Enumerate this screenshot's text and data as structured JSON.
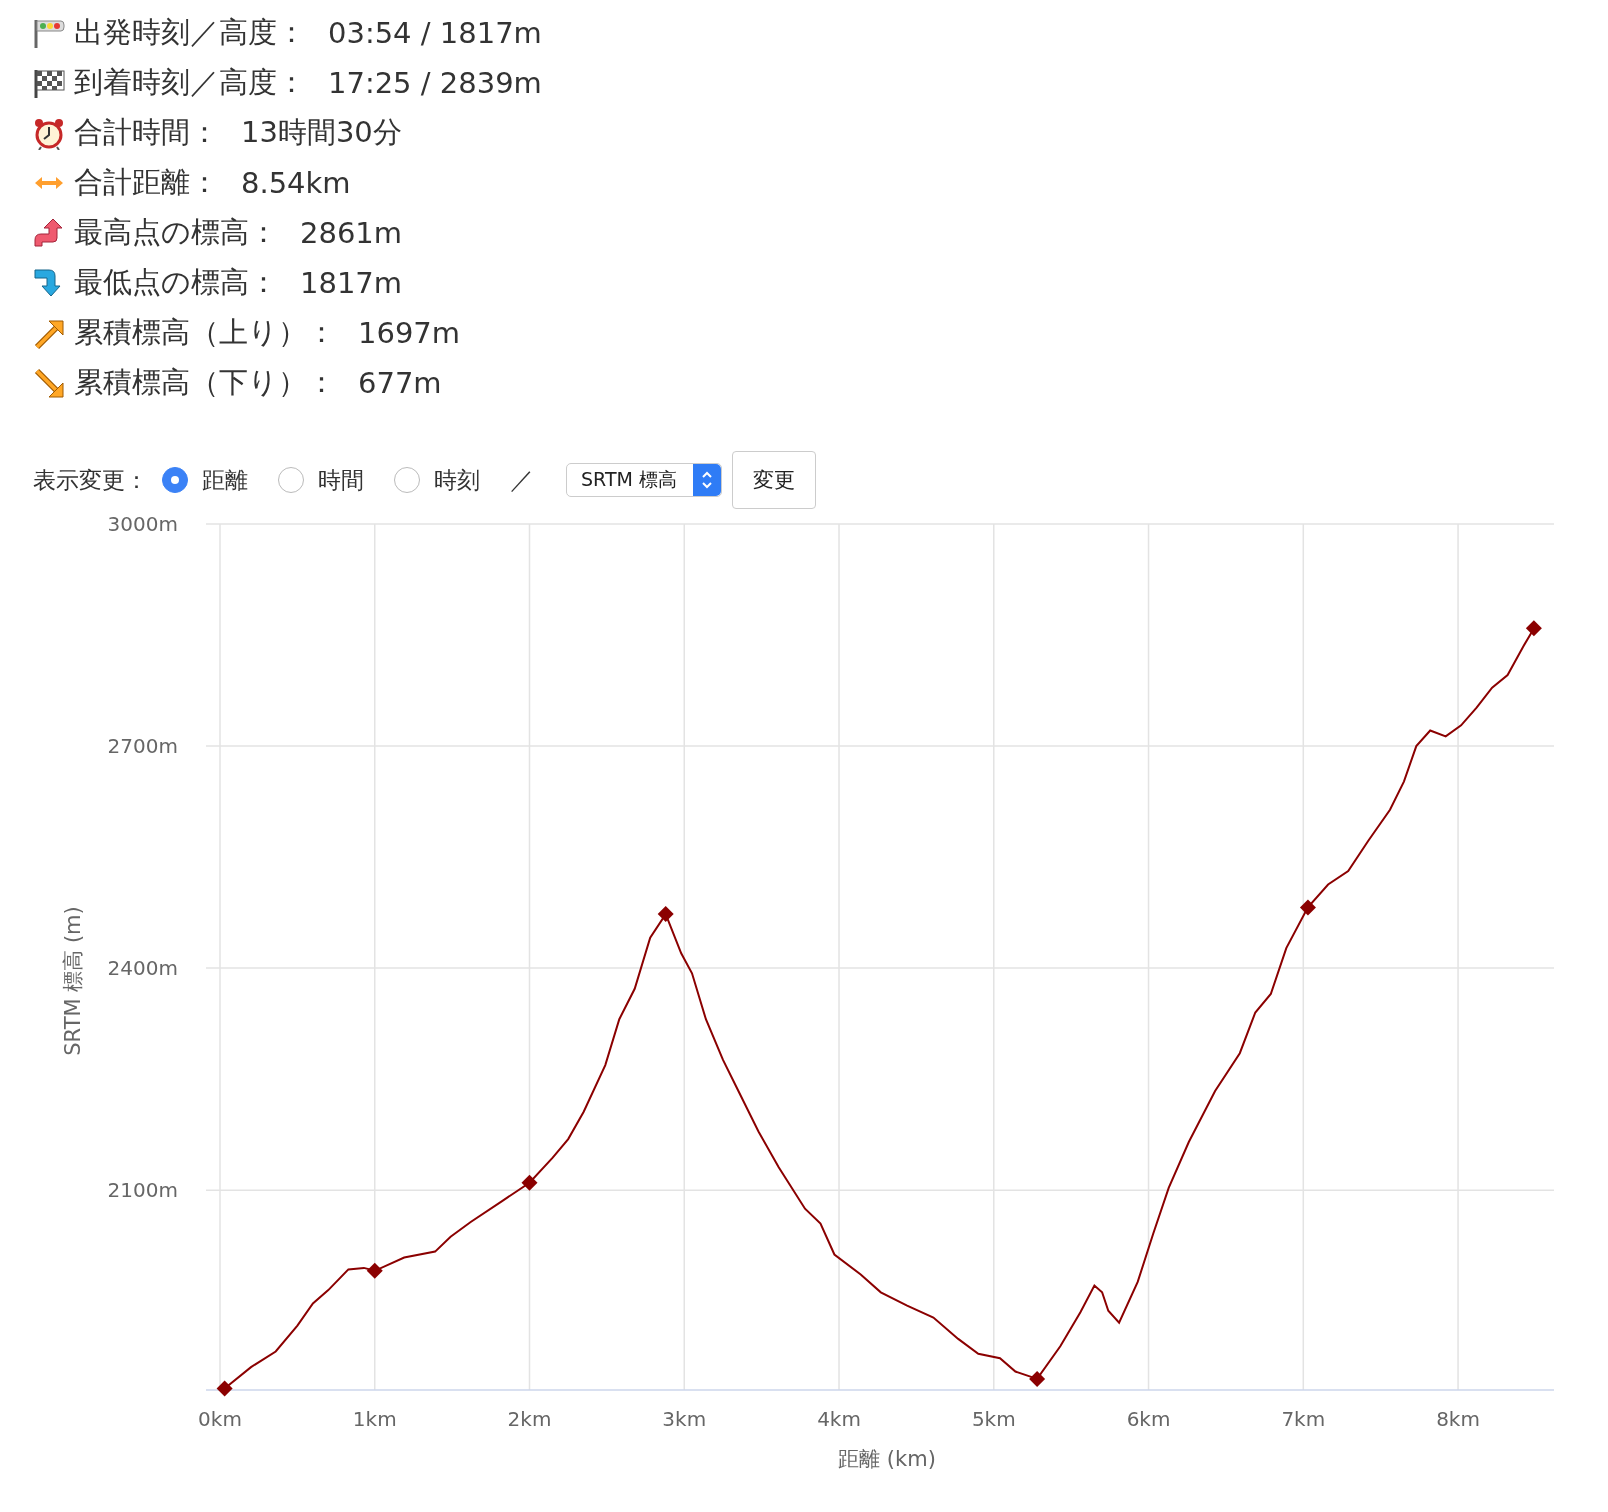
{
  "stats": [
    {
      "kind": "start",
      "label": "出発時刻／高度：",
      "value": "03:54 / 1817m"
    },
    {
      "kind": "finish",
      "label": "到着時刻／高度：",
      "value": "17:25 / 2839m"
    },
    {
      "kind": "time",
      "label": "合計時間：",
      "value": "13時間30分"
    },
    {
      "kind": "distance",
      "label": "合計距離：",
      "value": "8.54km"
    },
    {
      "kind": "highest",
      "label": "最高点の標高：",
      "value": "2861m"
    },
    {
      "kind": "lowest",
      "label": "最低点の標高：",
      "value": "1817m"
    },
    {
      "kind": "ascent",
      "label": "累積標高（上り）：",
      "value": "1697m"
    },
    {
      "kind": "descent",
      "label": "累積標高（下り）：",
      "value": "677m"
    }
  ],
  "display_controls": {
    "label": "表示変更：",
    "radios": [
      {
        "label": "距離",
        "selected": true
      },
      {
        "label": "時間",
        "selected": false
      },
      {
        "label": "時刻",
        "selected": false
      }
    ],
    "separator": "／",
    "select": {
      "value": "SRTM 標高"
    },
    "button": "変更"
  },
  "chart": {
    "chart_data": {
      "type": "line",
      "xlabel": "距離 (km)",
      "ylabel": "SRTM 標高 (m)",
      "x": [
        0.03,
        0.2,
        0.36,
        0.5,
        0.6,
        0.7,
        0.83,
        0.93,
        1.0,
        1.19,
        1.39,
        1.49,
        1.62,
        1.82,
        2.0,
        2.15,
        2.25,
        2.35,
        2.49,
        2.58,
        2.68,
        2.78,
        2.88,
        2.98,
        3.05,
        3.14,
        3.25,
        3.35,
        3.48,
        3.61,
        3.78,
        3.88,
        3.97,
        4.14,
        4.27,
        4.44,
        4.61,
        4.77,
        4.9,
        5.04,
        5.14,
        5.28,
        5.43,
        5.56,
        5.65,
        5.7,
        5.74,
        5.81,
        5.93,
        6.03,
        6.13,
        6.26,
        6.43,
        6.59,
        6.69,
        6.79,
        6.89,
        7.03,
        7.16,
        7.29,
        7.42,
        7.56,
        7.65,
        7.73,
        7.82,
        7.92,
        8.02,
        8.12,
        8.22,
        8.32,
        8.42,
        8.49
      ],
      "grid": true,
      "series": [
        {
          "color": "#8b0000",
          "values": [
            1832,
            1861,
            1882,
            1917,
            1947,
            1965,
            1993,
            1995,
            1991,
            2009,
            2017,
            2037,
            2057,
            2085,
            2110,
            2144,
            2169,
            2206,
            2269,
            2331,
            2372,
            2441,
            2473,
            2420,
            2393,
            2331,
            2276,
            2234,
            2179,
            2131,
            2075,
            2055,
            2013,
            1986,
            1962,
            1944,
            1928,
            1899,
            1879,
            1873,
            1855,
            1845,
            1889,
            1935,
            1971,
            1962,
            1937,
            1921,
            1976,
            2041,
            2103,
            2165,
            2234,
            2285,
            2340,
            2365,
            2427,
            2482,
            2513,
            2531,
            2572,
            2614,
            2652,
            2700,
            2721,
            2713,
            2728,
            2752,
            2779,
            2796,
            2834,
            2859
          ]
        },
        {
          "type": "scatter",
          "color": "#8b0000",
          "marker": "diamond",
          "values": [
            1832,
            null,
            null,
            null,
            null,
            null,
            null,
            null,
            1991,
            null,
            null,
            null,
            null,
            null,
            2110,
            null,
            null,
            null,
            null,
            null,
            null,
            null,
            2473,
            null,
            null,
            null,
            null,
            null,
            null,
            null,
            null,
            null,
            null,
            null,
            null,
            null,
            null,
            null,
            null,
            null,
            null,
            1845,
            null,
            null,
            null,
            null,
            null,
            null,
            null,
            null,
            null,
            null,
            null,
            null,
            null,
            null,
            null,
            2482,
            null,
            null,
            null,
            null,
            null,
            null,
            null,
            null,
            null,
            null,
            null,
            null,
            null,
            2859
          ]
        }
      ],
      "xlim": [
        0,
        8.62
      ],
      "ylim": [
        1830,
        3000
      ],
      "xticks": [
        {
          "value": 0,
          "label": "0km"
        },
        {
          "value": 1,
          "label": "1km"
        },
        {
          "value": 2,
          "label": "2km"
        },
        {
          "value": 3,
          "label": "3km"
        },
        {
          "value": 4,
          "label": "4km"
        },
        {
          "value": 5,
          "label": "5km"
        },
        {
          "value": 6,
          "label": "6km"
        },
        {
          "value": 7,
          "label": "7km"
        },
        {
          "value": 8,
          "label": "8km"
        }
      ],
      "yticks": [
        {
          "value": 2100,
          "label": "2100m"
        },
        {
          "value": 2400,
          "label": "2400m"
        },
        {
          "value": 2700,
          "label": "2700m"
        },
        {
          "value": 3000,
          "label": "3000m"
        }
      ]
    }
  }
}
